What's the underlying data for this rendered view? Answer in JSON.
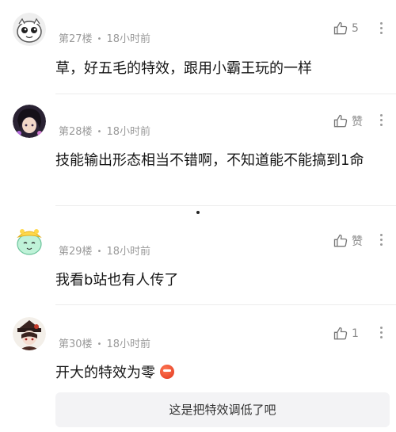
{
  "comments": [
    {
      "floor": "第27楼",
      "time": "18小时前",
      "likes": "5",
      "text": "草，好五毛的特效，跟用小霸王玩的一样",
      "avatar": "white-cat-avatar"
    },
    {
      "floor": "第28楼",
      "time": "18小时前",
      "likes": "赞",
      "text": "技能输出形态相当不错啊，不知道能不能搞到1命",
      "avatar": "dark-hair-character-avatar"
    },
    {
      "floor": "第29楼",
      "time": "18小时前",
      "likes": "赞",
      "text": "我看b站也有人传了",
      "avatar": "yellow-blob-avatar"
    },
    {
      "floor": "第30楼",
      "time": "18小时前",
      "likes": "1",
      "text": "开大的特效为零",
      "avatar": "hat-character-avatar"
    }
  ],
  "separator": "•",
  "reply_preview": "这是把特效调低了吧",
  "colors": {
    "meta": "#9a9a9a",
    "text": "#151515",
    "reply_bg": "#f3f3f5"
  },
  "icons": [
    "thumbs-up-icon",
    "more-vertical-icon",
    "angry-face-emoji"
  ]
}
